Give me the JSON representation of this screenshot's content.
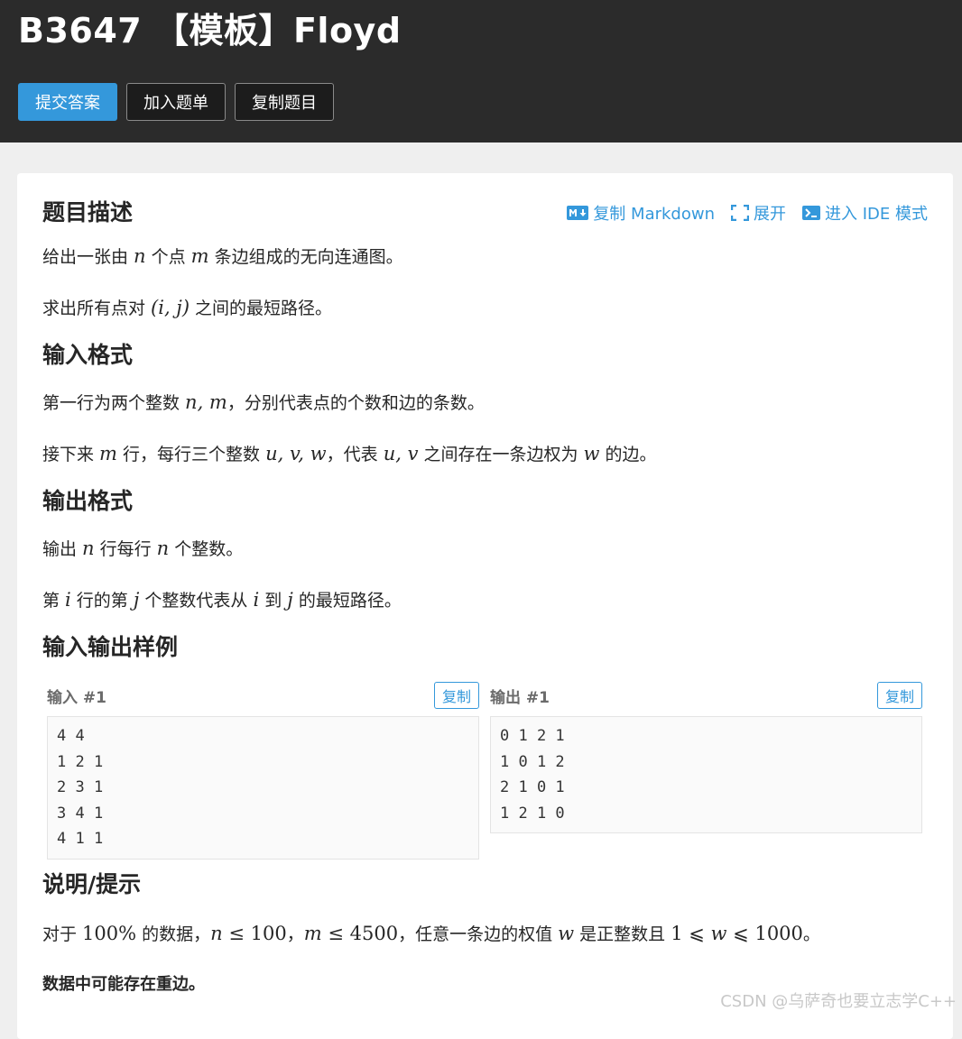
{
  "header": {
    "title": "B3647 【模板】Floyd",
    "buttons": {
      "submit": "提交答案",
      "add_list": "加入题单",
      "copy_problem": "复制题目"
    }
  },
  "toolbar": {
    "copy_markdown": "复制 Markdown",
    "expand": "展开",
    "ide_mode": "进入 IDE 模式"
  },
  "sections": {
    "description": {
      "title": "题目描述",
      "p1": {
        "a": "给出一张由 ",
        "n": "n",
        "b": " 个点 ",
        "m": "m",
        "c": " 条边组成的无向连通图。"
      },
      "p2": {
        "a": "求出所有点对 ",
        "pair": "(i, j)",
        "b": " 之间的最短路径。"
      }
    },
    "input_format": {
      "title": "输入格式",
      "p1": {
        "a": "第一行为两个整数 ",
        "nm": "n, m",
        "b": "，分别代表点的个数和边的条数。"
      },
      "p2": {
        "a": "接下来 ",
        "m": "m",
        "b": " 行，每行三个整数 ",
        "uvw": "u, v, w",
        "c": "，代表 ",
        "uv": "u, v",
        "d": " 之间存在一条边权为 ",
        "w": "w",
        "e": " 的边。"
      }
    },
    "output_format": {
      "title": "输出格式",
      "p1": {
        "a": "输出 ",
        "n1": "n",
        "b": " 行每行 ",
        "n2": "n",
        "c": " 个整数。"
      },
      "p2": {
        "a": "第 ",
        "i1": "i",
        "b": " 行的第 ",
        "j1": "j",
        "c": " 个整数代表从 ",
        "i2": "i",
        "d": " 到 ",
        "j2": "j",
        "e": " 的最短路径。"
      }
    },
    "samples": {
      "title": "输入输出样例",
      "input_label": "输入 #1",
      "output_label": "输出 #1",
      "copy": "复制",
      "input": "4 4\n1 2 1\n2 3 1\n3 4 1\n4 1 1",
      "output": "0 1 2 1\n1 0 1 2\n2 1 0 1\n1 2 1 0"
    },
    "hints": {
      "title": "说明/提示",
      "p1": {
        "a": "对于 ",
        "pct": "100%",
        "b": " 的数据，",
        "n": "n",
        "le1": " ≤ ",
        "v1": "100",
        "c": "，",
        "m": "m",
        "le2": " ≤ ",
        "v2": "4500",
        "d": "，任意一条边的权值 ",
        "w": "w",
        "e": " 是正整数且 ",
        "one": "1",
        "le3": " ⩽ ",
        "w2": "w",
        "le4": " ⩽ ",
        "v3": "1000",
        "f": "。"
      },
      "p2": "数据中可能存在重边。"
    }
  },
  "watermark": "CSDN @乌萨奇也要立志学C++"
}
